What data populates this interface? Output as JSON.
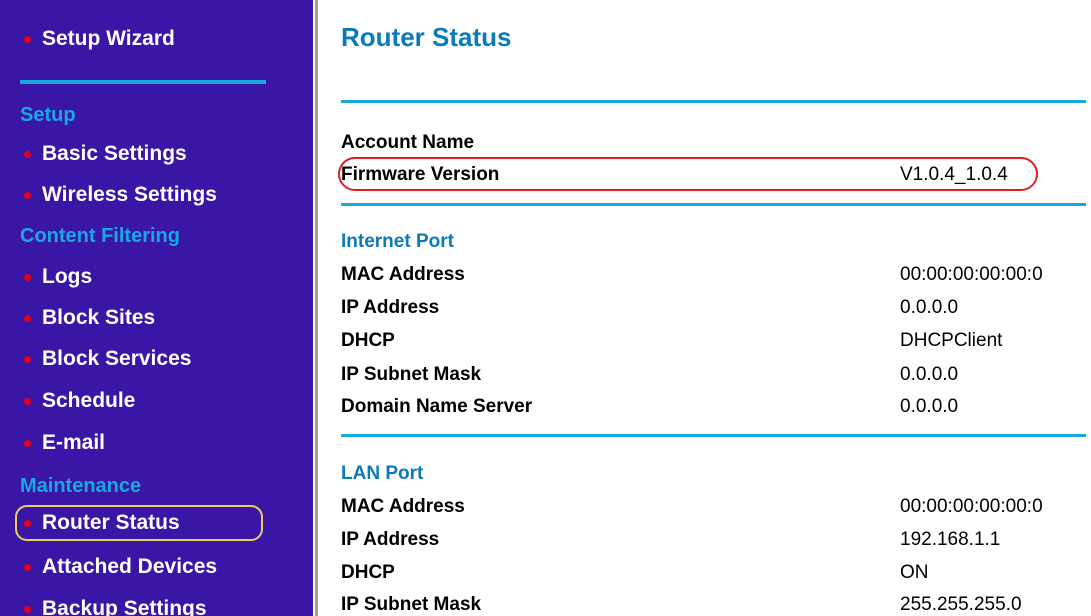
{
  "sidebar": {
    "setup_wizard": "Setup Wizard",
    "sections": {
      "setup": "Setup",
      "content_filtering": "Content Filtering",
      "maintenance": "Maintenance"
    },
    "items": {
      "basic_settings": "Basic Settings",
      "wireless_settings": "Wireless Settings",
      "logs": "Logs",
      "block_sites": "Block Sites",
      "block_services": "Block Services",
      "schedule": "Schedule",
      "email": "E-mail",
      "router_status": "Router Status",
      "attached_devices": "Attached Devices",
      "backup_settings": "Backup Settings"
    },
    "bullet_color": "#e0001a",
    "background_color": "#3a16a6",
    "section_color": "#18a8e0"
  },
  "main": {
    "title": "Router Status",
    "account": {
      "account_name_label": "Account Name",
      "account_name_value": "",
      "firmware_label": "Firmware Version",
      "firmware_value": "V1.0.4_1.0.4"
    },
    "internet_port": {
      "heading": "Internet Port",
      "rows": [
        {
          "label": "MAC Address",
          "value": "00:00:00:00:00:0"
        },
        {
          "label": "IP Address",
          "value": "0.0.0.0"
        },
        {
          "label": "DHCP",
          "value": "DHCPClient"
        },
        {
          "label": "IP Subnet Mask",
          "value": "0.0.0.0"
        },
        {
          "label": "Domain Name Server",
          "value": "0.0.0.0"
        }
      ]
    },
    "lan_port": {
      "heading": "LAN Port",
      "rows": [
        {
          "label": "MAC Address",
          "value": "00:00:00:00:00:0"
        },
        {
          "label": "IP Address",
          "value": "192.168.1.1"
        },
        {
          "label": "DHCP",
          "value": "ON"
        },
        {
          "label": "IP Subnet Mask",
          "value": "255.255.255.0"
        }
      ]
    }
  }
}
